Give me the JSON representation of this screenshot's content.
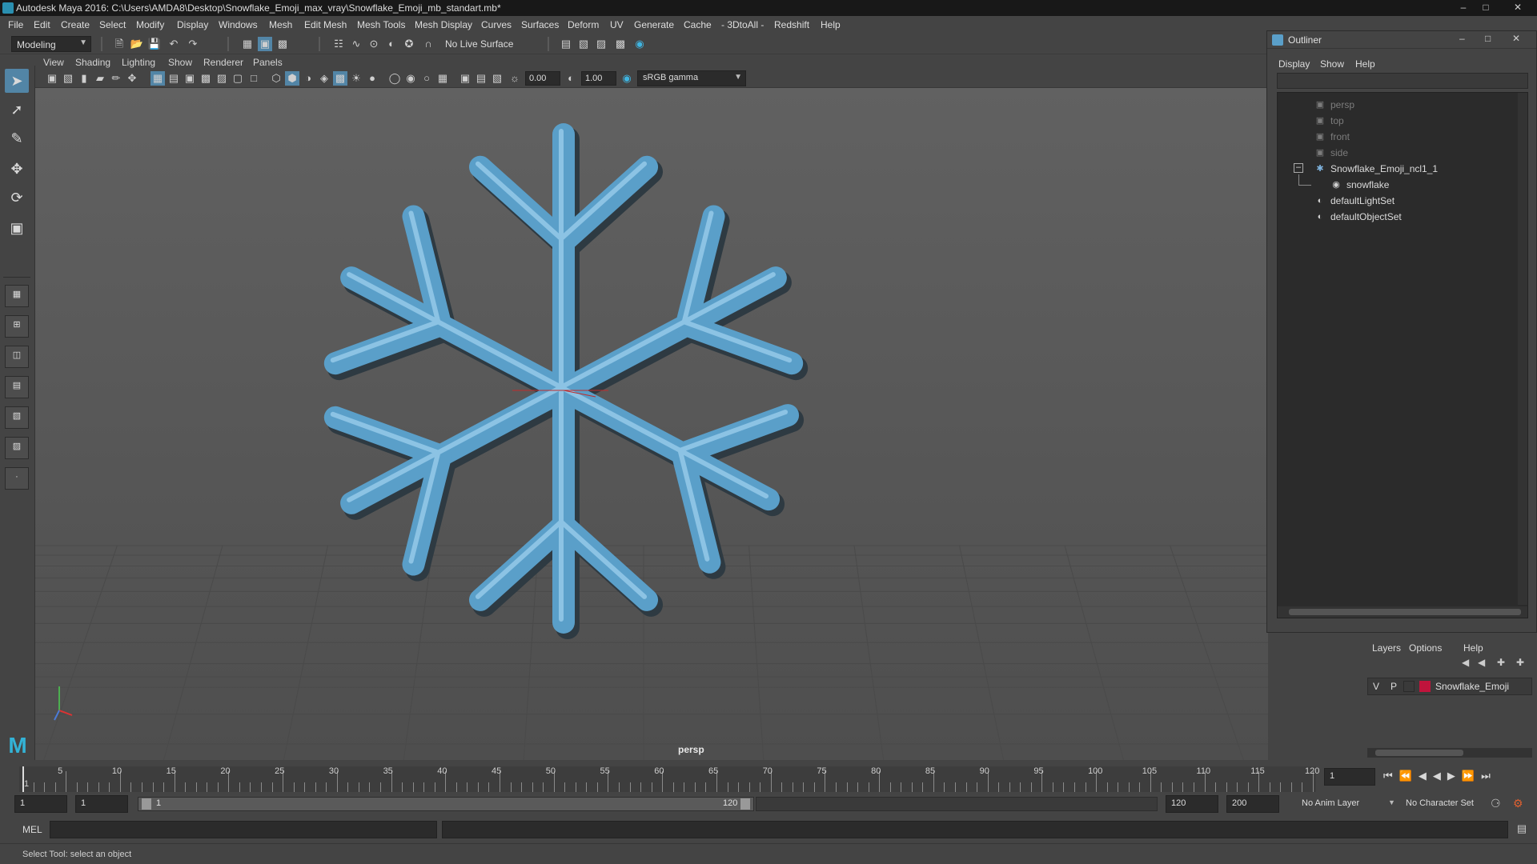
{
  "window": {
    "title": "Autodesk Maya 2016: C:\\Users\\AMDA8\\Desktop\\Snowflake_Emoji_max_vray\\Snowflake_Emoji_mb_standart.mb*"
  },
  "menubar": {
    "items": [
      "File",
      "Edit",
      "Create",
      "Select",
      "Modify",
      "Display",
      "Windows",
      "Mesh",
      "Edit Mesh",
      "Mesh Tools",
      "Mesh Display",
      "Curves",
      "Surfaces",
      "Deform",
      "UV",
      "Generate",
      "Cache",
      "- 3DtoAll -",
      "Redshift",
      "Help"
    ]
  },
  "statusbar": {
    "mode": "Modeling",
    "live_surface": "No Live Surface"
  },
  "viewport": {
    "menu": [
      "View",
      "Shading",
      "Lighting",
      "Show",
      "Renderer",
      "Panels"
    ],
    "exposure": "0.00",
    "gamma": "1.00",
    "color_space": "sRGB gamma",
    "camera_label": "persp",
    "object_color": "#5a9fc9"
  },
  "outliner": {
    "title": "Outliner",
    "menu": [
      "Display",
      "Show",
      "Help"
    ],
    "items": [
      {
        "label": "persp",
        "icon": "camera-icon",
        "dim": true
      },
      {
        "label": "top",
        "icon": "camera-icon",
        "dim": true
      },
      {
        "label": "front",
        "icon": "camera-icon",
        "dim": true
      },
      {
        "label": "side",
        "icon": "camera-icon",
        "dim": true
      },
      {
        "label": "Snowflake_Emoji_ncl1_1",
        "icon": "group-icon",
        "dim": false
      },
      {
        "label": "snowflake",
        "icon": "mesh-icon",
        "dim": false
      },
      {
        "label": "defaultLightSet",
        "icon": "set-icon",
        "dim": false
      },
      {
        "label": "defaultObjectSet",
        "icon": "set-icon",
        "dim": false
      }
    ]
  },
  "layers": {
    "menu": [
      "Layers",
      "Options",
      "Help"
    ],
    "layer": {
      "visible": "V",
      "playback": "P",
      "name": "Snowflake_Emoji",
      "color": "#c0143c"
    }
  },
  "timeline": {
    "ticks": [
      "1",
      "5",
      "10",
      "15",
      "20",
      "25",
      "30",
      "35",
      "40",
      "45",
      "50",
      "55",
      "60",
      "65",
      "70",
      "75",
      "80",
      "85",
      "90",
      "95",
      "100",
      "105",
      "110",
      "115",
      "120"
    ],
    "current_frame": "1"
  },
  "range": {
    "start": "1",
    "playback_start": "1",
    "slider_start": "1",
    "slider_end": "120",
    "playback_end": "120",
    "end": "200",
    "anim_layer": "No Anim Layer",
    "character_set": "No Character Set"
  },
  "cmdline": {
    "label": "MEL"
  },
  "helpline": {
    "text": "Select Tool: select an object"
  }
}
